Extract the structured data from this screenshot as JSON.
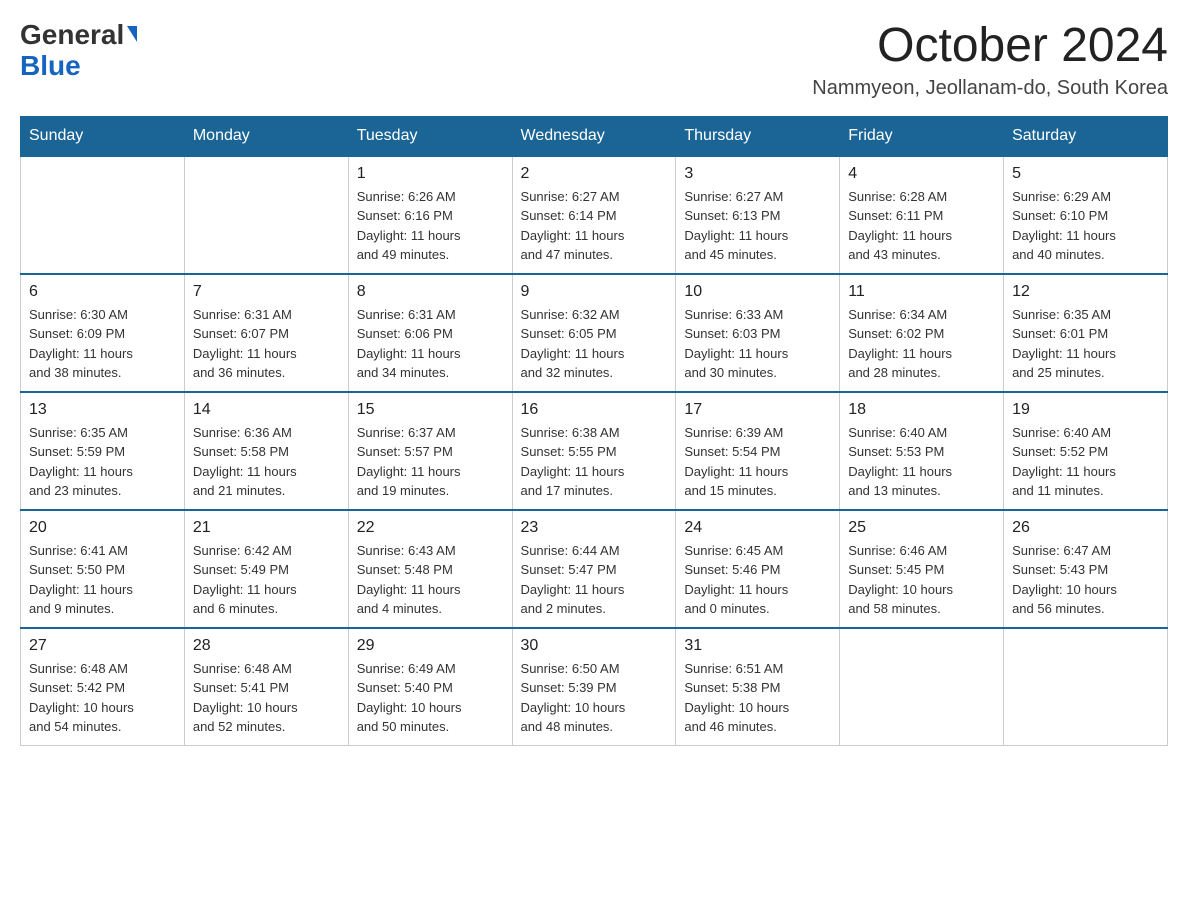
{
  "logo": {
    "text_black": "General",
    "text_blue": "Blue",
    "line2": "Blue"
  },
  "header": {
    "title": "October 2024",
    "subtitle": "Nammyeon, Jeollanam-do, South Korea"
  },
  "weekdays": [
    "Sunday",
    "Monday",
    "Tuesday",
    "Wednesday",
    "Thursday",
    "Friday",
    "Saturday"
  ],
  "weeks": [
    [
      {
        "day": "",
        "info": ""
      },
      {
        "day": "",
        "info": ""
      },
      {
        "day": "1",
        "info": "Sunrise: 6:26 AM\nSunset: 6:16 PM\nDaylight: 11 hours\nand 49 minutes."
      },
      {
        "day": "2",
        "info": "Sunrise: 6:27 AM\nSunset: 6:14 PM\nDaylight: 11 hours\nand 47 minutes."
      },
      {
        "day": "3",
        "info": "Sunrise: 6:27 AM\nSunset: 6:13 PM\nDaylight: 11 hours\nand 45 minutes."
      },
      {
        "day": "4",
        "info": "Sunrise: 6:28 AM\nSunset: 6:11 PM\nDaylight: 11 hours\nand 43 minutes."
      },
      {
        "day": "5",
        "info": "Sunrise: 6:29 AM\nSunset: 6:10 PM\nDaylight: 11 hours\nand 40 minutes."
      }
    ],
    [
      {
        "day": "6",
        "info": "Sunrise: 6:30 AM\nSunset: 6:09 PM\nDaylight: 11 hours\nand 38 minutes."
      },
      {
        "day": "7",
        "info": "Sunrise: 6:31 AM\nSunset: 6:07 PM\nDaylight: 11 hours\nand 36 minutes."
      },
      {
        "day": "8",
        "info": "Sunrise: 6:31 AM\nSunset: 6:06 PM\nDaylight: 11 hours\nand 34 minutes."
      },
      {
        "day": "9",
        "info": "Sunrise: 6:32 AM\nSunset: 6:05 PM\nDaylight: 11 hours\nand 32 minutes."
      },
      {
        "day": "10",
        "info": "Sunrise: 6:33 AM\nSunset: 6:03 PM\nDaylight: 11 hours\nand 30 minutes."
      },
      {
        "day": "11",
        "info": "Sunrise: 6:34 AM\nSunset: 6:02 PM\nDaylight: 11 hours\nand 28 minutes."
      },
      {
        "day": "12",
        "info": "Sunrise: 6:35 AM\nSunset: 6:01 PM\nDaylight: 11 hours\nand 25 minutes."
      }
    ],
    [
      {
        "day": "13",
        "info": "Sunrise: 6:35 AM\nSunset: 5:59 PM\nDaylight: 11 hours\nand 23 minutes."
      },
      {
        "day": "14",
        "info": "Sunrise: 6:36 AM\nSunset: 5:58 PM\nDaylight: 11 hours\nand 21 minutes."
      },
      {
        "day": "15",
        "info": "Sunrise: 6:37 AM\nSunset: 5:57 PM\nDaylight: 11 hours\nand 19 minutes."
      },
      {
        "day": "16",
        "info": "Sunrise: 6:38 AM\nSunset: 5:55 PM\nDaylight: 11 hours\nand 17 minutes."
      },
      {
        "day": "17",
        "info": "Sunrise: 6:39 AM\nSunset: 5:54 PM\nDaylight: 11 hours\nand 15 minutes."
      },
      {
        "day": "18",
        "info": "Sunrise: 6:40 AM\nSunset: 5:53 PM\nDaylight: 11 hours\nand 13 minutes."
      },
      {
        "day": "19",
        "info": "Sunrise: 6:40 AM\nSunset: 5:52 PM\nDaylight: 11 hours\nand 11 minutes."
      }
    ],
    [
      {
        "day": "20",
        "info": "Sunrise: 6:41 AM\nSunset: 5:50 PM\nDaylight: 11 hours\nand 9 minutes."
      },
      {
        "day": "21",
        "info": "Sunrise: 6:42 AM\nSunset: 5:49 PM\nDaylight: 11 hours\nand 6 minutes."
      },
      {
        "day": "22",
        "info": "Sunrise: 6:43 AM\nSunset: 5:48 PM\nDaylight: 11 hours\nand 4 minutes."
      },
      {
        "day": "23",
        "info": "Sunrise: 6:44 AM\nSunset: 5:47 PM\nDaylight: 11 hours\nand 2 minutes."
      },
      {
        "day": "24",
        "info": "Sunrise: 6:45 AM\nSunset: 5:46 PM\nDaylight: 11 hours\nand 0 minutes."
      },
      {
        "day": "25",
        "info": "Sunrise: 6:46 AM\nSunset: 5:45 PM\nDaylight: 10 hours\nand 58 minutes."
      },
      {
        "day": "26",
        "info": "Sunrise: 6:47 AM\nSunset: 5:43 PM\nDaylight: 10 hours\nand 56 minutes."
      }
    ],
    [
      {
        "day": "27",
        "info": "Sunrise: 6:48 AM\nSunset: 5:42 PM\nDaylight: 10 hours\nand 54 minutes."
      },
      {
        "day": "28",
        "info": "Sunrise: 6:48 AM\nSunset: 5:41 PM\nDaylight: 10 hours\nand 52 minutes."
      },
      {
        "day": "29",
        "info": "Sunrise: 6:49 AM\nSunset: 5:40 PM\nDaylight: 10 hours\nand 50 minutes."
      },
      {
        "day": "30",
        "info": "Sunrise: 6:50 AM\nSunset: 5:39 PM\nDaylight: 10 hours\nand 48 minutes."
      },
      {
        "day": "31",
        "info": "Sunrise: 6:51 AM\nSunset: 5:38 PM\nDaylight: 10 hours\nand 46 minutes."
      },
      {
        "day": "",
        "info": ""
      },
      {
        "day": "",
        "info": ""
      }
    ]
  ]
}
